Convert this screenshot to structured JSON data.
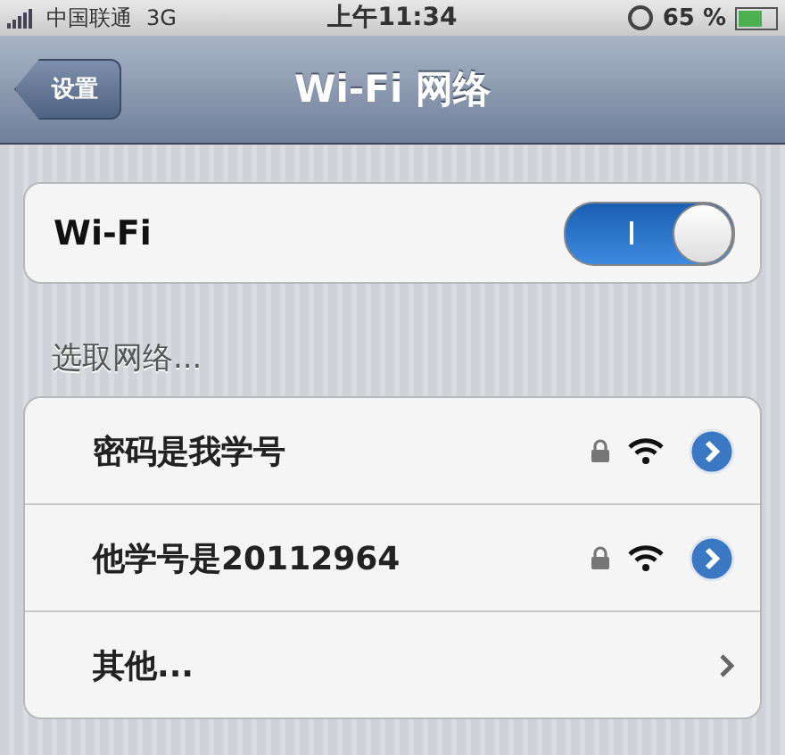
{
  "status_bar": {
    "carrier": "中国联通",
    "network": "3G",
    "time": "上午11:34",
    "battery": "65 %"
  },
  "nav": {
    "back": "设置",
    "title": "Wi-Fi 网络"
  },
  "wifi": {
    "label": "Wi-Fi",
    "on": true
  },
  "section_label": "选取网络...",
  "networks": [
    {
      "kind": "network",
      "name": "密码是我学号",
      "locked": true
    },
    {
      "kind": "network",
      "name": "他学号是20112964",
      "locked": true
    },
    {
      "kind": "other",
      "name": "其他..."
    }
  ]
}
